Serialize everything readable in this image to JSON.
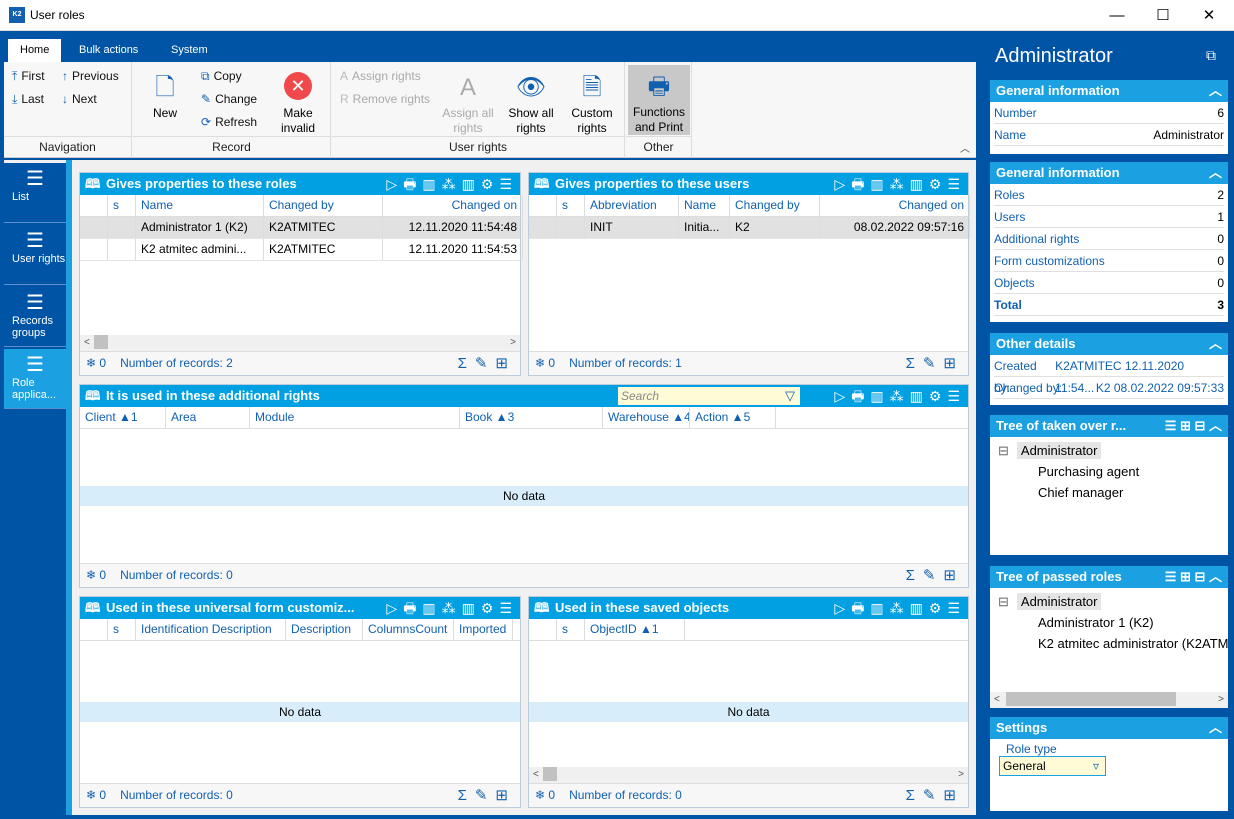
{
  "window": {
    "title": "User roles",
    "minimize": "—",
    "maximize": "☐",
    "close": "✕"
  },
  "ribbon": {
    "tabs": [
      "Home",
      "Bulk actions",
      "System"
    ],
    "groups": {
      "navigation": "Navigation",
      "record": "Record",
      "user_rights": "User rights",
      "other": "Other"
    },
    "nav": {
      "first": "First",
      "previous": "Previous",
      "last": "Last",
      "next": "Next"
    },
    "record": {
      "new": "New",
      "copy": "Copy",
      "change": "Change",
      "refresh": "Refresh",
      "make_invalid": "Make invalid"
    },
    "rights": {
      "assign": "Assign rights",
      "remove": "Remove rights",
      "assign_all": "Assign all rights",
      "show_all": "Show all rights",
      "custom": "Custom rights"
    },
    "other": {
      "functions": "Functions and Print"
    }
  },
  "leftnav": [
    {
      "label": "List"
    },
    {
      "label": "User rights"
    },
    {
      "label": "Records groups"
    },
    {
      "label": "Role applica...",
      "selected": true
    }
  ],
  "panels": [
    {
      "title": "Gives properties to these roles",
      "columns": [
        "",
        "s",
        "Name",
        "Changed by",
        "Changed on"
      ],
      "rows": [
        [
          "",
          "",
          "Administrator 1 (K2)",
          "K2ATMITEC",
          "12.11.2020 11:54:48"
        ],
        [
          "",
          "",
          "K2 atmitec admini...",
          "K2ATMITEC",
          "12.11.2020 11:54:53"
        ]
      ],
      "filter_count": "0",
      "records": "Number of records: 2"
    },
    {
      "title": "Gives properties to these users",
      "columns": [
        "",
        "s",
        "Abbreviation",
        "Name",
        "Changed by",
        "Changed on"
      ],
      "rows": [
        [
          "",
          "",
          "INIT",
          "Initia...",
          "K2",
          "08.02.2022 09:57:16"
        ]
      ],
      "filter_count": "0",
      "records": "Number of records: 1"
    },
    {
      "title": "It is used in these additional rights",
      "search_placeholder": "Search",
      "columns": [
        "Client ▲1",
        "Area",
        "Module",
        "Book ▲3",
        "Warehouse ▲4",
        "Action ▲5"
      ],
      "rows": [],
      "no_data": "No data",
      "filter_count": "0",
      "records": "Number of records: 0"
    },
    {
      "title": "Used in these universal form customiz...",
      "columns": [
        "",
        "s",
        "Identification Description",
        "Description",
        "ColumnsCount",
        "Imported"
      ],
      "rows": [],
      "no_data": "No data",
      "filter_count": "0",
      "records": "Number of records: 0"
    },
    {
      "title": "Used in these saved objects",
      "columns": [
        "",
        "s",
        "ObjectID ▲1"
      ],
      "rows": [],
      "no_data": "No data",
      "filter_count": "0",
      "records": "Number of records: 0"
    }
  ],
  "right": {
    "title": "Administrator",
    "general1": {
      "title": "General information",
      "items": [
        {
          "k": "Number",
          "v": "6"
        },
        {
          "k": "Name",
          "v": "Administrator"
        }
      ]
    },
    "general2": {
      "title": "General information",
      "items": [
        {
          "k": "Roles",
          "v": "2"
        },
        {
          "k": "Users",
          "v": "1"
        },
        {
          "k": "Additional rights",
          "v": "0"
        },
        {
          "k": "Form customizations",
          "v": "0"
        },
        {
          "k": "Objects",
          "v": "0"
        },
        {
          "k": "Total",
          "v": "3"
        }
      ]
    },
    "other": {
      "title": "Other details",
      "created_label": "Created by:",
      "created_value": "K2ATMITEC 12.11.2020 11:54...",
      "changed_label": "Changed by:",
      "changed_value": "K2 08.02.2022 09:57:33"
    },
    "tree_taken": {
      "title": "Tree of taken over r...",
      "root": "Administrator",
      "children": [
        "Purchasing agent",
        "Chief manager"
      ]
    },
    "tree_passed": {
      "title": "Tree of passed roles",
      "root": "Administrator",
      "children": [
        "Administrator 1 (K2)",
        "K2 atmitec administrator (K2ATM"
      ]
    },
    "settings": {
      "title": "Settings",
      "role_type_label": "Role type",
      "role_type_value": "General"
    }
  },
  "colors": {
    "dark_blue": "#0054a6",
    "header_blue": "#00a0e3",
    "accent": "#1ba1e2"
  }
}
